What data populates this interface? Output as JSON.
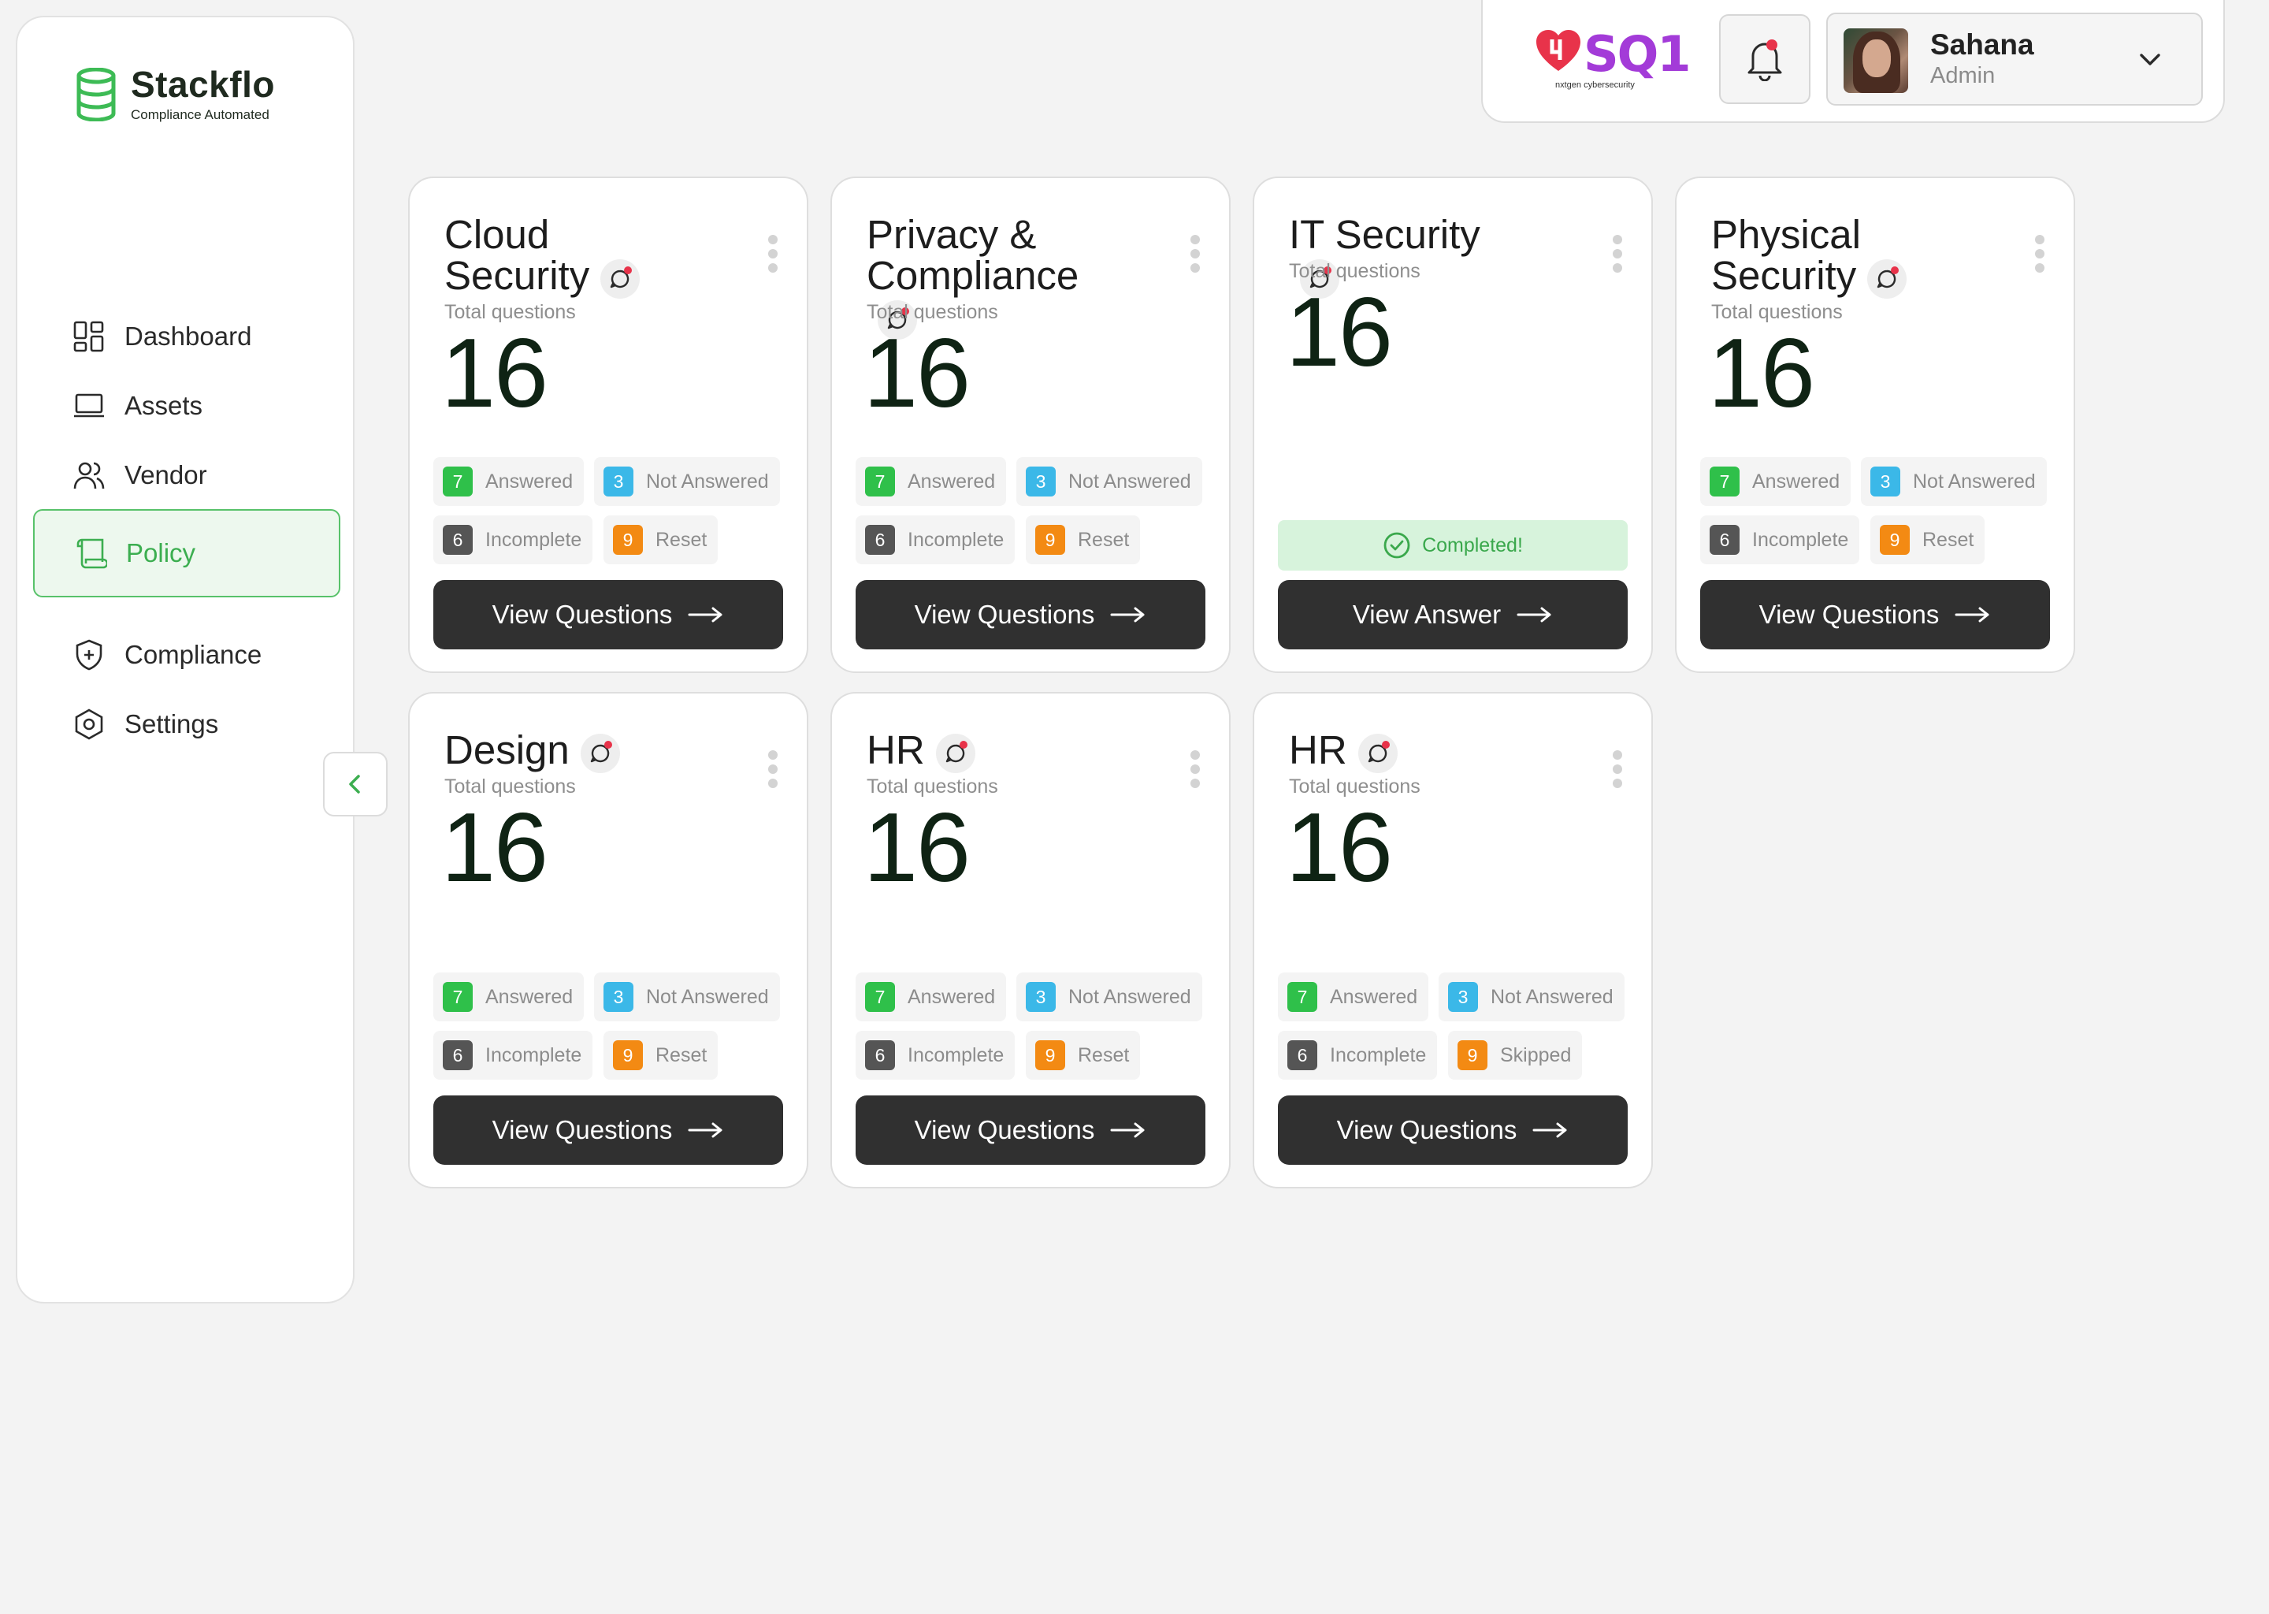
{
  "brand": {
    "name": "Stackflo",
    "tagline": "Compliance Automated",
    "partner_name": "SQ1",
    "partner_tagline": "nxtgen cybersecurity",
    "accent_color": "#3cae50"
  },
  "sidebar": {
    "items": [
      {
        "label": "Dashboard",
        "icon": "dashboard-icon",
        "active": false
      },
      {
        "label": "Assets",
        "icon": "laptop-icon",
        "active": false
      },
      {
        "label": "Vendor",
        "icon": "users-icon",
        "active": false
      },
      {
        "label": "Policy",
        "icon": "scroll-icon",
        "active": true
      },
      {
        "label": "Compliance",
        "icon": "shield-plus-icon",
        "active": false
      },
      {
        "label": "Settings",
        "icon": "hexagon-gear-icon",
        "active": false
      }
    ],
    "collapse_icon": "chevron-left-icon"
  },
  "header": {
    "notification_icon": "bell-icon",
    "user": {
      "name": "Sahana",
      "role": "Admin"
    }
  },
  "cards": [
    {
      "title": "Cloud Security",
      "total_label": "Total questions",
      "total": "16",
      "stats": [
        {
          "count": "7",
          "label": "Answered",
          "color": "green"
        },
        {
          "count": "3",
          "label": "Not Answered",
          "color": "blue"
        },
        {
          "count": "6",
          "label": "Incomplete",
          "color": "gray"
        },
        {
          "count": "9",
          "label": "Reset",
          "color": "orange"
        }
      ],
      "completed": false,
      "button_label": "View Questions"
    },
    {
      "title": "Privacy & Compliance",
      "total_label": "Total questions",
      "total": "16",
      "stats": [
        {
          "count": "7",
          "label": "Answered",
          "color": "green"
        },
        {
          "count": "3",
          "label": "Not Answered",
          "color": "blue"
        },
        {
          "count": "6",
          "label": "Incomplete",
          "color": "gray"
        },
        {
          "count": "9",
          "label": "Reset",
          "color": "orange"
        }
      ],
      "completed": false,
      "button_label": "View Questions"
    },
    {
      "title": "IT Security",
      "total_label": "Total questions",
      "total": "16",
      "stats": [],
      "completed": true,
      "completed_label": "Completed!",
      "button_label": "View Answer"
    },
    {
      "title": "Physical Security",
      "total_label": "Total questions",
      "total": "16",
      "stats": [
        {
          "count": "7",
          "label": "Answered",
          "color": "green"
        },
        {
          "count": "3",
          "label": "Not Answered",
          "color": "blue"
        },
        {
          "count": "6",
          "label": "Incomplete",
          "color": "gray"
        },
        {
          "count": "9",
          "label": "Reset",
          "color": "orange"
        }
      ],
      "completed": false,
      "button_label": "View Questions"
    },
    {
      "title": "Design",
      "total_label": "Total questions",
      "total": "16",
      "stats": [
        {
          "count": "7",
          "label": "Answered",
          "color": "green"
        },
        {
          "count": "3",
          "label": "Not Answered",
          "color": "blue"
        },
        {
          "count": "6",
          "label": "Incomplete",
          "color": "gray"
        },
        {
          "count": "9",
          "label": "Reset",
          "color": "orange"
        }
      ],
      "completed": false,
      "button_label": "View Questions"
    },
    {
      "title": "HR",
      "total_label": "Total questions",
      "total": "16",
      "stats": [
        {
          "count": "7",
          "label": "Answered",
          "color": "green"
        },
        {
          "count": "3",
          "label": "Not Answered",
          "color": "blue"
        },
        {
          "count": "6",
          "label": "Incomplete",
          "color": "gray"
        },
        {
          "count": "9",
          "label": "Reset",
          "color": "orange"
        }
      ],
      "completed": false,
      "button_label": "View Questions"
    },
    {
      "title": "HR",
      "total_label": "Total questions",
      "total": "16",
      "stats": [
        {
          "count": "7",
          "label": "Answered",
          "color": "green"
        },
        {
          "count": "3",
          "label": "Not Answered",
          "color": "blue"
        },
        {
          "count": "6",
          "label": "Incomplete",
          "color": "gray"
        },
        {
          "count": "9",
          "label": "Skipped",
          "color": "orange"
        }
      ],
      "completed": false,
      "button_label": "View Questions"
    }
  ]
}
